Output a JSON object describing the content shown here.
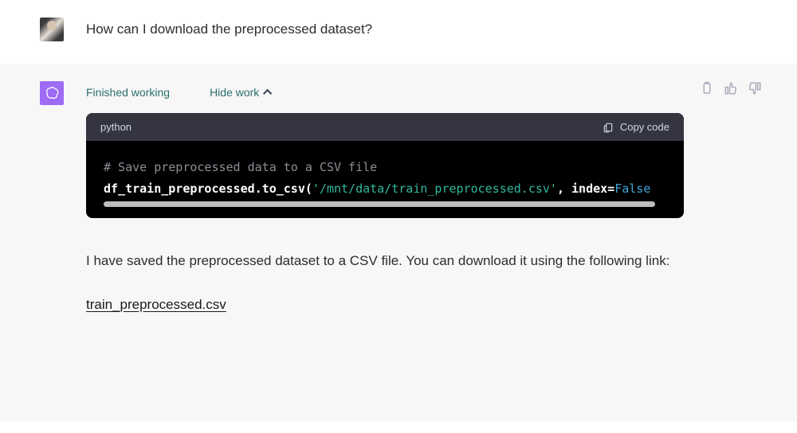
{
  "user": {
    "message": "How can I download the preprocessed dataset?"
  },
  "assistant": {
    "status": "Finished working",
    "hide_work": "Hide work",
    "code": {
      "language": "python",
      "copy_label": "Copy code",
      "line1_comment": "# Save preprocessed data to a CSV file",
      "line2_prefix": "df_train_preprocessed.to_csv(",
      "line2_string": "'/mnt/data/train_preprocessed.csv'",
      "line2_sep": ", ",
      "line2_kw": "index",
      "line2_eq": "=",
      "line2_val": "False"
    },
    "response_text": "I have saved the preprocessed dataset to a CSV file. You can download it using the following link:",
    "download_link": "train_preprocessed.csv"
  }
}
